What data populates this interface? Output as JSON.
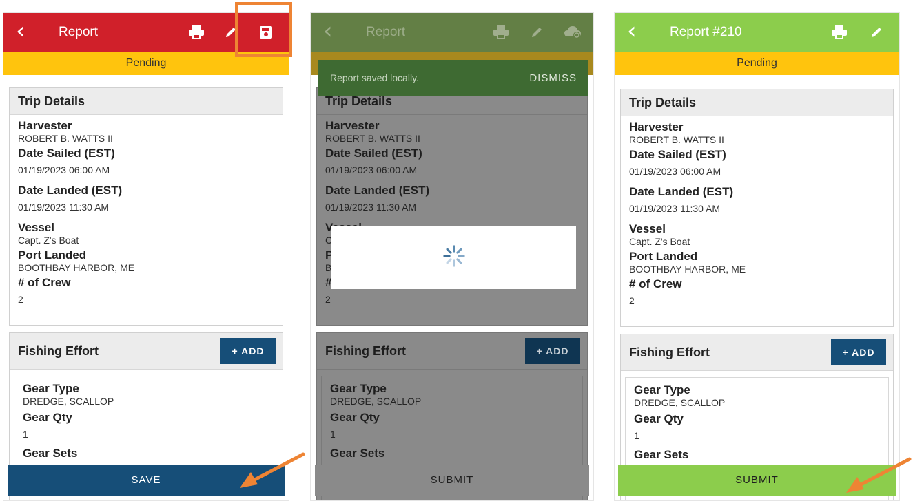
{
  "panel1": {
    "title": "Report",
    "status": "Pending",
    "save_label": "SAVE"
  },
  "panel2": {
    "title": "Report",
    "toast_message": "Report saved locally.",
    "toast_action": "DISMISS",
    "submit_label": "SUBMIT"
  },
  "panel3": {
    "title": "Report #210",
    "status": "Pending",
    "submit_label": "SUBMIT"
  },
  "trip": {
    "heading": "Trip Details",
    "harvester_label": "Harvester",
    "harvester_value": "ROBERT B. WATTS II",
    "sailed_label": "Date Sailed (EST)",
    "sailed_value": "01/19/2023 06:00 AM",
    "landed_label": "Date Landed (EST)",
    "landed_value": "01/19/2023 11:30 AM",
    "vessel_label": "Vessel",
    "vessel_value": "Capt. Z's Boat",
    "port_label": "Port Landed",
    "port_value": "BOOTHBAY HARBOR, ME",
    "crew_label": "# of Crew",
    "crew_value": "2"
  },
  "effort": {
    "heading": "Fishing Effort",
    "add_label": "+ ADD",
    "gear_type_label": "Gear Type",
    "gear_type_value": "DREDGE, SCALLOP",
    "gear_qty_label": "Gear Qty",
    "gear_qty_value": "1",
    "gear_sets_label": "Gear Sets"
  },
  "icons": [
    "chevron-left-icon",
    "print-icon",
    "pencil-icon",
    "floppy-disk-icon",
    "cloud-sync-icon",
    "spinner-icon",
    "arrow-annotation-icon"
  ],
  "colors": {
    "red_bar": "#d0202a",
    "green_bar": "#8ccd4c",
    "pending": "#ffc40d",
    "navy_button": "#164e78",
    "highlight_orange": "#ee8434"
  }
}
